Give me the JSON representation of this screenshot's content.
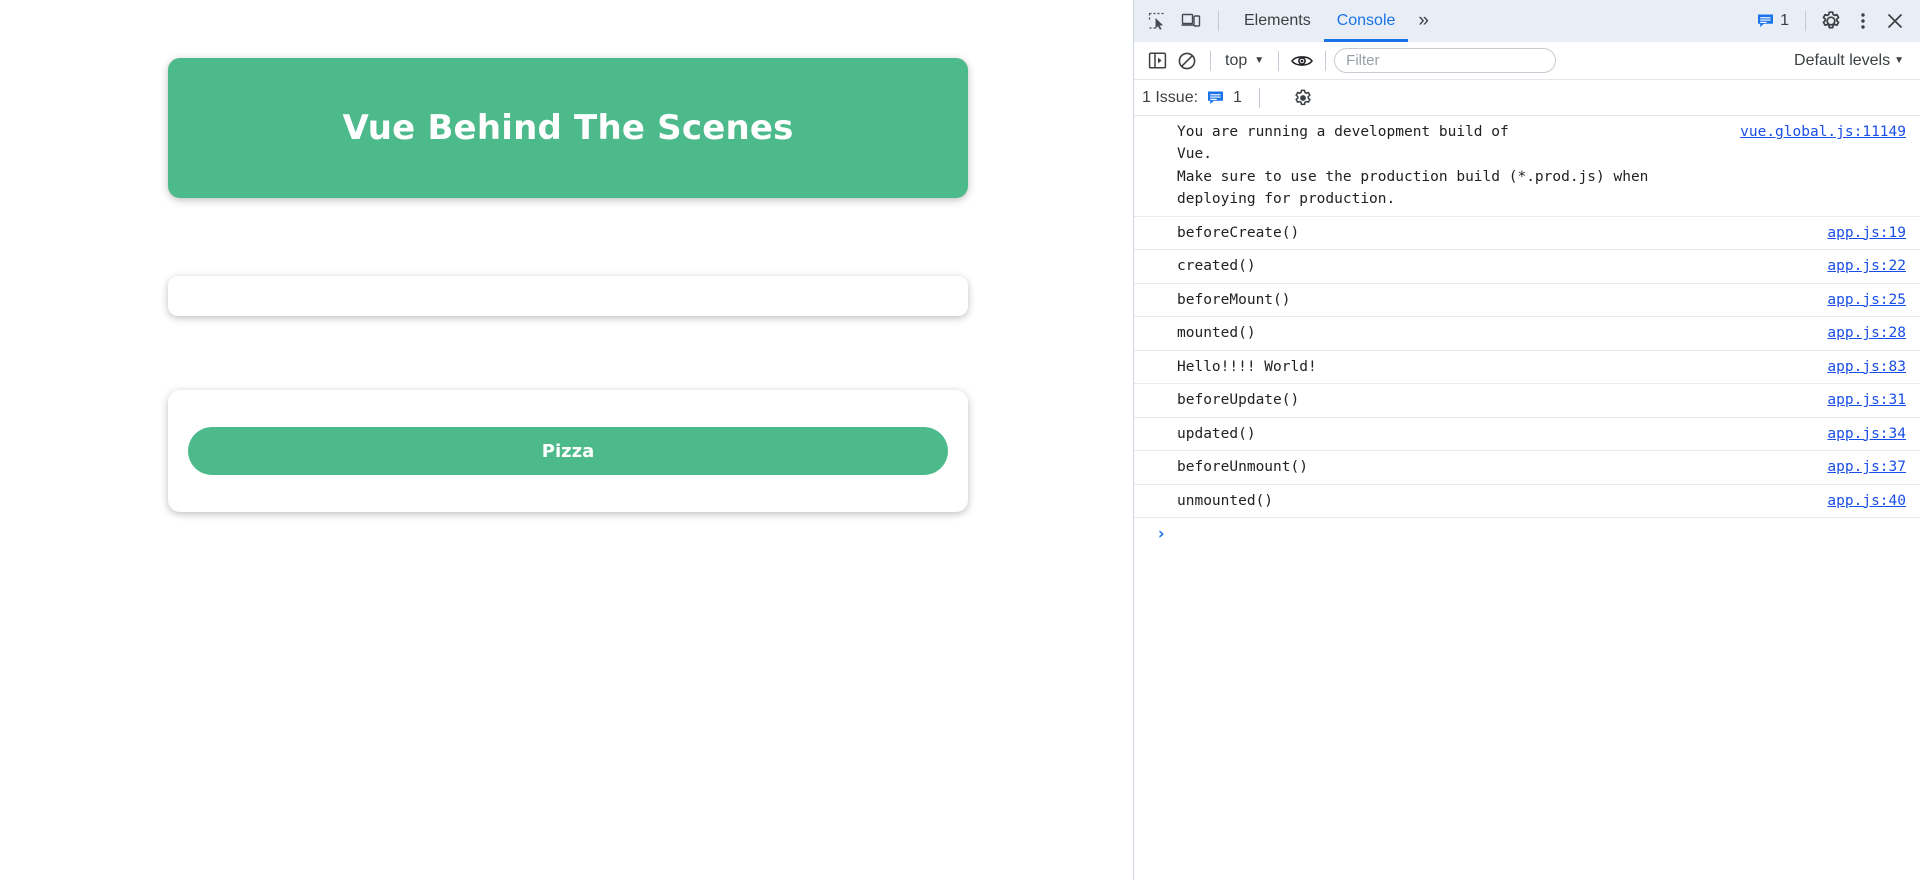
{
  "page": {
    "header_title": "Vue Behind The Scenes",
    "text_input_value": "",
    "text_input_placeholder": "",
    "pizza_button_label": "Pizza",
    "accent_color": "#4CBA8A"
  },
  "devtools": {
    "tabbar": {
      "inspect_icon": "inspect-element-icon",
      "device_icon": "device-toolbar-icon",
      "tabs": [
        {
          "label": "Elements",
          "active": false
        },
        {
          "label": "Console",
          "active": true
        }
      ],
      "more_tabs_label": "»",
      "issues_badge_count": "1",
      "settings_icon": "gear-icon",
      "menu_icon": "kebab-menu-icon",
      "close_icon": "close-icon"
    },
    "toolbar": {
      "sidebar_toggle_icon": "show-console-sidebar-icon",
      "clear_icon": "clear-console-icon",
      "context_label": "top",
      "context_caret": "▼",
      "eye_icon": "live-expression-eye-icon",
      "filter_placeholder": "Filter",
      "filter_value": "",
      "levels_label": "Default levels",
      "levels_caret": "▼"
    },
    "issuebar": {
      "text": "1 Issue:",
      "badge_icon": "issue-badge-icon",
      "count": "1",
      "gear_icon": "issues-settings-gear-icon"
    },
    "console": {
      "messages": [
        {
          "text": "You are running a development build of\nVue.\nMake sure to use the production build (*.prod.js) when\ndeploying for production.",
          "source": "vue.global.js:11149"
        },
        {
          "text": "beforeCreate()",
          "source": "app.js:19"
        },
        {
          "text": "created()",
          "source": "app.js:22"
        },
        {
          "text": "beforeMount()",
          "source": "app.js:25"
        },
        {
          "text": "mounted()",
          "source": "app.js:28"
        },
        {
          "text": "Hello!!!! World!",
          "source": "app.js:83"
        },
        {
          "text": "beforeUpdate()",
          "source": "app.js:31"
        },
        {
          "text": "updated()",
          "source": "app.js:34"
        },
        {
          "text": "beforeUnmount()",
          "source": "app.js:37"
        },
        {
          "text": "unmounted()",
          "source": "app.js:40"
        }
      ],
      "prompt_caret": "›",
      "prompt_value": ""
    }
  }
}
